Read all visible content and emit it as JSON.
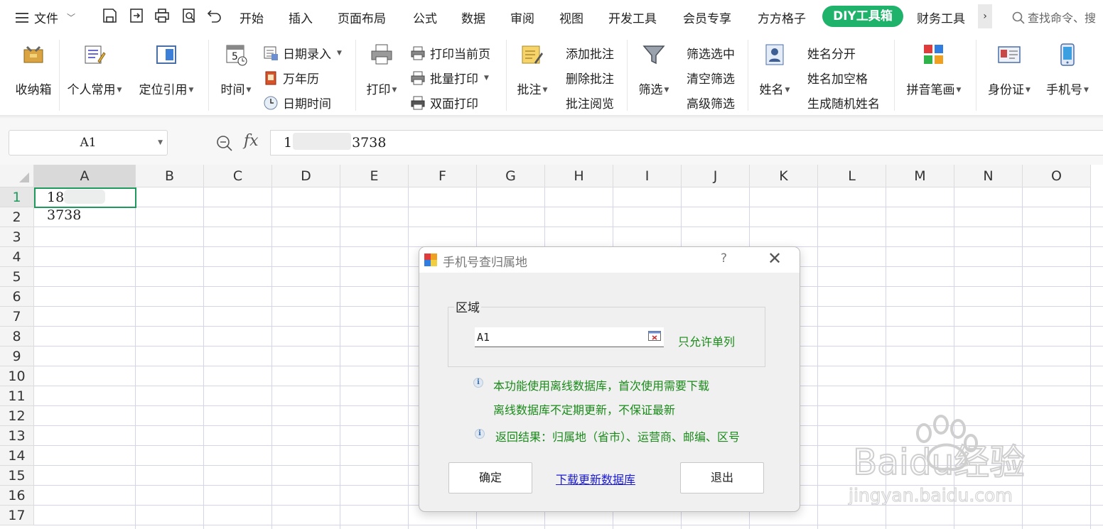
{
  "menubar": {
    "file_label": "文件",
    "tabs": [
      "开始",
      "插入",
      "页面布局",
      "公式",
      "数据",
      "审阅",
      "视图",
      "开发工具",
      "会员专享",
      "方方格子",
      "DIY工具箱",
      "财务工具"
    ],
    "active_tab": "DIY工具箱",
    "more_label": "›",
    "search_placeholder": "查找命令、搜"
  },
  "ribbon": {
    "inbox": "收纳箱",
    "personal": "个人常用",
    "locate": "定位引用",
    "time": "时间",
    "date_entry": "日期录入",
    "calendar": "万年历",
    "datetime": "日期时间",
    "print": "打印",
    "print_current": "打印当前页",
    "batch_print": "批量打印",
    "duplex_print": "双面打印",
    "comment": "批注",
    "add_comment": "添加批注",
    "delete_comment": "删除批注",
    "read_comment": "批注阅览",
    "filter": "筛选",
    "filter_selected": "筛选选中",
    "clear_filter": "清空筛选",
    "advanced_filter": "高级筛选",
    "name": "姓名",
    "split_name": "姓名分开",
    "name_space": "姓名加空格",
    "random_name": "生成随机姓名",
    "pinyin": "拼音笔画",
    "id_card": "身份证",
    "phone": "手机号"
  },
  "formula_bar": {
    "name_box": "A1",
    "fx": "fx",
    "content_visible_prefix": "1",
    "content_visible_suffix": "3738"
  },
  "grid": {
    "columns": [
      "A",
      "B",
      "C",
      "D",
      "E",
      "F",
      "G",
      "H",
      "I",
      "J",
      "K",
      "L",
      "M",
      "N",
      "O"
    ],
    "rows": [
      "1",
      "2",
      "3",
      "4",
      "5",
      "6",
      "7",
      "8",
      "9",
      "10",
      "11",
      "12",
      "13",
      "14",
      "15",
      "16",
      "17"
    ],
    "selected_cell": "A1",
    "a1_visible_prefix": "18",
    "a1_visible_suffix": "3738"
  },
  "dialog": {
    "title": "手机号查归属地",
    "help": "?",
    "close": "✕",
    "group_label": "区域",
    "range_value": "A1",
    "single_column_note": "只允许单列",
    "info1_line1": "本功能使用离线数据库，首次使用需要下载",
    "info1_line2": "离线数据库不定期更新，不保证最新",
    "info2": "返回结果：归属地（省市）、运营商、邮编、区号",
    "ok": "确定",
    "download": "下载更新数据库",
    "exit": "退出"
  },
  "watermark": {
    "brand": "Baidu经验",
    "url": "jingyan.baidu.com"
  },
  "colors": {
    "accent": "#1fb26b",
    "selection": "#1e9b5c",
    "info_text": "#1a8a1a",
    "link": "#1a1ad4"
  }
}
